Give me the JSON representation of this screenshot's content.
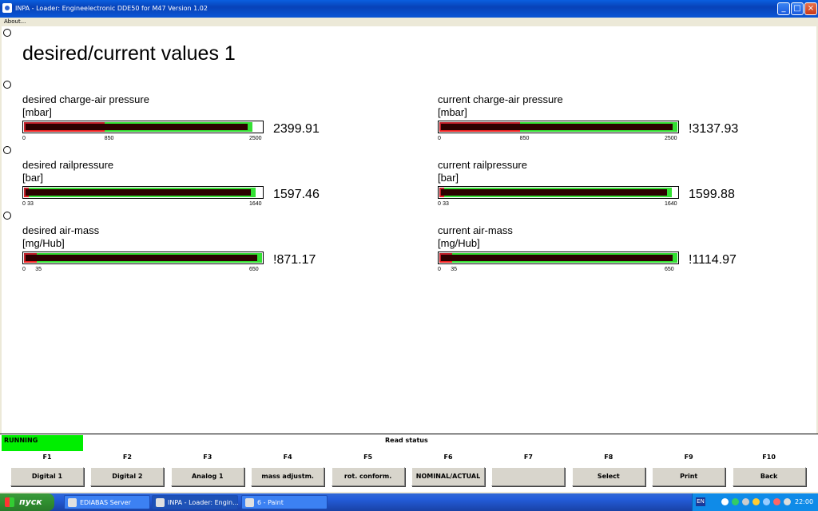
{
  "window": {
    "title": "INPA - Loader:  Engineelectronic DDE50 for M47 Version 1.02"
  },
  "menu": {
    "about": "About..."
  },
  "page": {
    "title": "desired/current values 1"
  },
  "gauges": [
    {
      "name": "desired charge-air pressure",
      "unit": "[mbar]",
      "value_text": "2399.91",
      "ticks": [
        "0",
        "850",
        "2500"
      ],
      "min": 0,
      "max": 2500,
      "limit": 850,
      "fraction": 0.96
    },
    {
      "name": "current charge-air pressure",
      "unit": "[mbar]",
      "value_text": "!3137.93",
      "ticks": [
        "0",
        "850",
        "2500"
      ],
      "min": 0,
      "max": 2500,
      "limit": 850,
      "fraction": 1.0
    },
    {
      "name": "desired railpressure",
      "unit": "[bar]",
      "value_text": "1597.46",
      "ticks": [
        "0",
        "33",
        "1640"
      ],
      "min": 0,
      "max": 1640,
      "limit": 33,
      "fraction": 0.974
    },
    {
      "name": "current railpressure",
      "unit": "[bar]",
      "value_text": "1599.88",
      "ticks": [
        "0",
        "33",
        "1640"
      ],
      "min": 0,
      "max": 1640,
      "limit": 33,
      "fraction": 0.976
    },
    {
      "name": "desired air-mass",
      "unit": "[mg/Hub]",
      "value_text": "!871.17",
      "ticks": [
        "0",
        "35",
        "650"
      ],
      "min": 0,
      "max": 650,
      "limit": 35,
      "fraction": 1.0
    },
    {
      "name": "current air-mass",
      "unit": "[mg/Hub]",
      "value_text": "!1114.97",
      "ticks": [
        "0",
        "35",
        "650"
      ],
      "min": 0,
      "max": 650,
      "limit": 35,
      "fraction": 1.0
    }
  ],
  "status": {
    "running": "RUNNING",
    "read_status": "Read status"
  },
  "fkeys": [
    {
      "key": "F1",
      "label": "Digital 1"
    },
    {
      "key": "F2",
      "label": "Digital 2"
    },
    {
      "key": "F3",
      "label": "Analog 1"
    },
    {
      "key": "F4",
      "label": "mass adjustm."
    },
    {
      "key": "F5",
      "label": "rot. conform."
    },
    {
      "key": "F6",
      "label": "NOMINAL/ACTUAL"
    },
    {
      "key": "F7",
      "label": ""
    },
    {
      "key": "F8",
      "label": "Select"
    },
    {
      "key": "F9",
      "label": "Print"
    },
    {
      "key": "F10",
      "label": "Back"
    }
  ],
  "taskbar": {
    "start": "пуск",
    "tasks": [
      "EDIABAS Server",
      "INPA - Loader:  Engin...",
      "6 - Paint"
    ],
    "lang": "EN",
    "clock": "22:00"
  },
  "colors": {
    "bar_fill": "#33e033",
    "bar_dark": "#2c0000",
    "bar_red": "#c2202a",
    "running": "#00ee00"
  }
}
